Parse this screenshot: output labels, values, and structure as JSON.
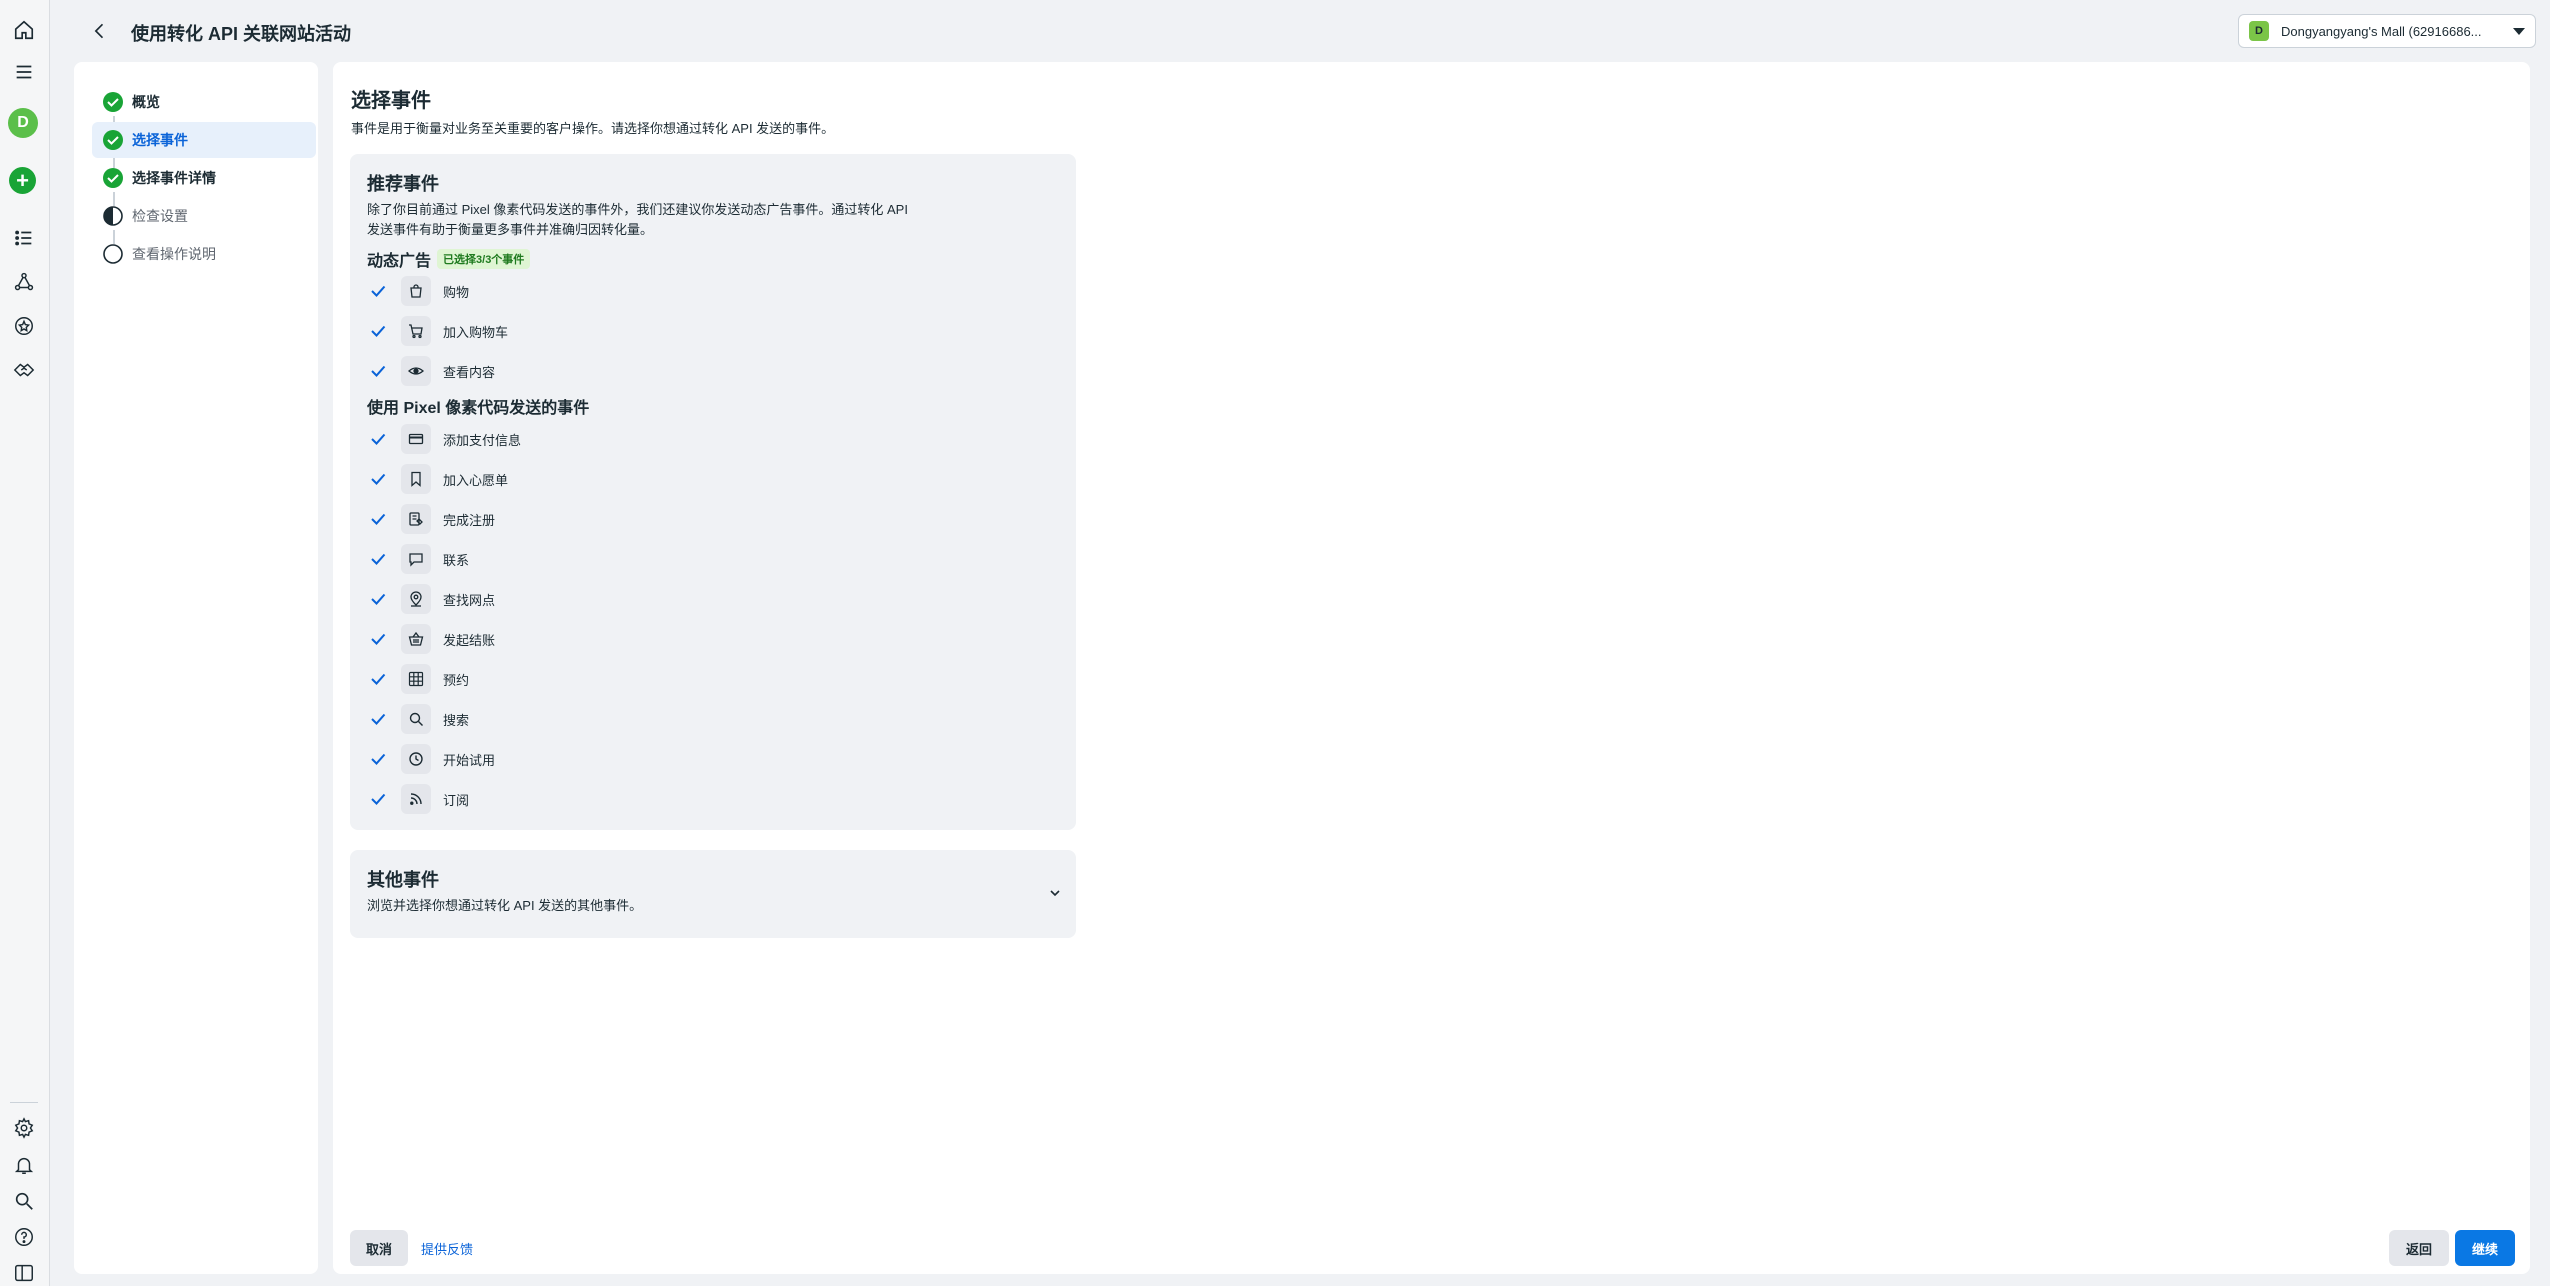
{
  "header": {
    "title": "使用转化 API 关联网站活动",
    "account": {
      "badge": "D",
      "name": "Dongyangyang's Mall (62916686..."
    }
  },
  "rail": {
    "avatar": "D",
    "add": "+"
  },
  "steps": [
    {
      "label": "概览",
      "status": "done"
    },
    {
      "label": "选择事件",
      "status": "done-active"
    },
    {
      "label": "选择事件详情",
      "status": "done"
    },
    {
      "label": "检查设置",
      "status": "half"
    },
    {
      "label": "查看操作说明",
      "status": "empty"
    }
  ],
  "main": {
    "title": "选择事件",
    "description": "事件是用于衡量对业务至关重要的客户操作。请选择你想通过转化 API 发送的事件。",
    "recommended": {
      "title": "推荐事件",
      "description_line1": "除了你目前通过 Pixel 像素代码发送的事件外，我们还建议你发送动态广告事件。通过转化 API",
      "description_line2": "发送事件有助于衡量更多事件并准确归因转化量。",
      "dynamic_ads": {
        "title": "动态广告",
        "badge": "已选择3/3个事件",
        "events": [
          {
            "label": "购物",
            "icon": "shopping-bag-icon",
            "checked": true
          },
          {
            "label": "加入购物车",
            "icon": "cart-icon",
            "checked": true
          },
          {
            "label": "查看内容",
            "icon": "eye-icon",
            "checked": true
          }
        ]
      },
      "pixel_events": {
        "title": "使用 Pixel 像素代码发送的事件",
        "events": [
          {
            "label": "添加支付信息",
            "icon": "credit-card-icon",
            "checked": true
          },
          {
            "label": "加入心愿单",
            "icon": "bookmark-icon",
            "checked": true
          },
          {
            "label": "完成注册",
            "icon": "registration-icon",
            "checked": true
          },
          {
            "label": "联系",
            "icon": "chat-bubble-icon",
            "checked": true
          },
          {
            "label": "查找网点",
            "icon": "location-pin-icon",
            "checked": true
          },
          {
            "label": "发起结账",
            "icon": "basket-icon",
            "checked": true
          },
          {
            "label": "预约",
            "icon": "calendar-grid-icon",
            "checked": true
          },
          {
            "label": "搜索",
            "icon": "search-icon",
            "checked": true
          },
          {
            "label": "开始试用",
            "icon": "clock-icon",
            "checked": true
          },
          {
            "label": "订阅",
            "icon": "rss-icon",
            "checked": true
          }
        ]
      }
    },
    "other": {
      "title": "其他事件",
      "description": "浏览并选择你想通过转化 API 发送的其他事件。"
    }
  },
  "footer": {
    "cancel": "取消",
    "feedback": "提供反馈",
    "back": "返回",
    "continue": "继续"
  },
  "colors": {
    "primary": "#0a78e4",
    "success": "#19a436",
    "link": "#0a63d8"
  }
}
